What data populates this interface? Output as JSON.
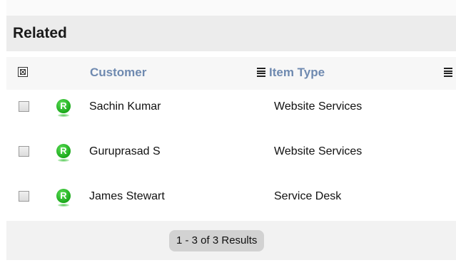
{
  "panel": {
    "title": "Related"
  },
  "columns": {
    "customer": "Customer",
    "item_type": "Item Type"
  },
  "rows": [
    {
      "badge": "R",
      "customer": "Sachin Kumar",
      "item_type": "Website Services"
    },
    {
      "badge": "R",
      "customer": "Guruprasad S",
      "item_type": "Website Services"
    },
    {
      "badge": "R",
      "customer": "James Stewart",
      "item_type": "Service Desk"
    }
  ],
  "footer": {
    "results": "1 - 3 of 3 Results"
  },
  "icons": {
    "select_all": "checkbox-select-all-icon",
    "column_menu": "column-menu-icon",
    "badge": "requester-badge-icon"
  },
  "colors": {
    "column_header_text": "#6f8ab0",
    "badge_green": "#1aa81a",
    "header_bg": "#ececec"
  }
}
